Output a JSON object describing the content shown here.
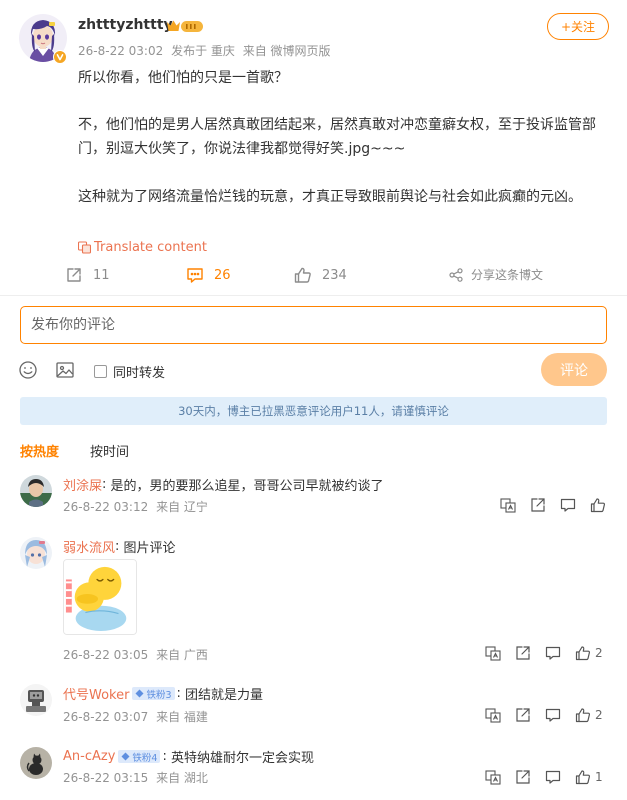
{
  "post": {
    "author": "zhtttyzhttty",
    "time": "26-8-22 03:02",
    "location": "发布于 重庆",
    "source": "来自 微博网页版",
    "follow_label": "+关注",
    "paragraphs": [
      "所以你看，他们怕的只是一首歌？",
      "不，他们怕的是男人居然真敢团结起来，居然真敢对冲恋童癖女权，至于投诉监管部门，别逗大伙笑了，你说法律我都觉得好笑.jpg~~~",
      "这种就为了网络流量恰烂钱的玩意，才真正导致眼前舆论与社会如此疯癫的元凶。"
    ],
    "translate_label": "Translate content",
    "reposts": "11",
    "comments": "26",
    "likes": "234",
    "share_label": "分享这条博文"
  },
  "composer": {
    "placeholder": "发布你的评论",
    "repost_label": "同时转发",
    "submit_label": "评论"
  },
  "notice": "30天内，博主已拉黑恶意评论用户11人，请谨慎评论",
  "sort": {
    "hot": "按热度",
    "time": "按时间"
  },
  "comments": [
    {
      "name": "刘涂屎",
      "text": "是的，男的要那么追星，哥哥公司早就被约谈了",
      "time": "26-8-22 03:12",
      "location": "来自 辽宁",
      "likes": ""
    },
    {
      "name": "弱水流风",
      "text": "图片评论",
      "time": "26-8-22 03:05",
      "location": "来自 广西",
      "likes": "2"
    },
    {
      "name": "代号Woker",
      "fan_badge": "铁粉3",
      "text": "团结就是力量",
      "time": "26-8-22 03:07",
      "location": "来自 福建",
      "likes": "2"
    },
    {
      "name": "An-cAzy",
      "fan_badge": "铁粉4",
      "text": "英特纳雄耐尔一定会实现",
      "time": "26-8-22 03:15",
      "location": "来自 湖北",
      "likes": "1"
    }
  ],
  "colors": {
    "accent": "#ff8200",
    "name_link": "#eb7350",
    "submit_disabled": "#ffc78c",
    "notice_bg": "#e0eefa"
  }
}
